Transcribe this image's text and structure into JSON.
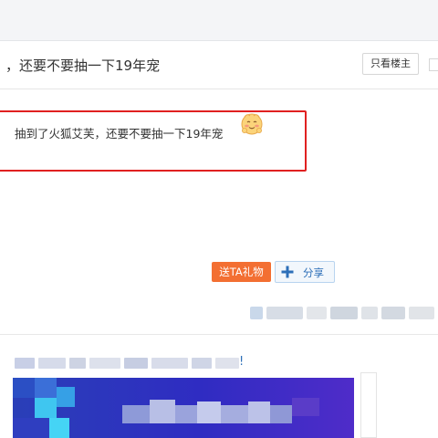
{
  "thread": {
    "title": "，还要不要抽一下19年宠",
    "only_op_label": "只看楼主"
  },
  "post": {
    "text": "抽到了火狐艾芙，还要不要抽一下19年宠",
    "emoji": "smiling-face-with-blush-emoji"
  },
  "actions": {
    "gift_label": "送TA礼物",
    "share_label": "分享"
  },
  "ad": {
    "exclaim": "!"
  },
  "colors": {
    "accent_red": "#e02020",
    "gift_orange": "#f36f32",
    "link_blue": "#2d6fb8",
    "banner_blue": "#2a3fb8"
  },
  "icons": [
    "plus-share-icon",
    "chevron-left-icon"
  ]
}
